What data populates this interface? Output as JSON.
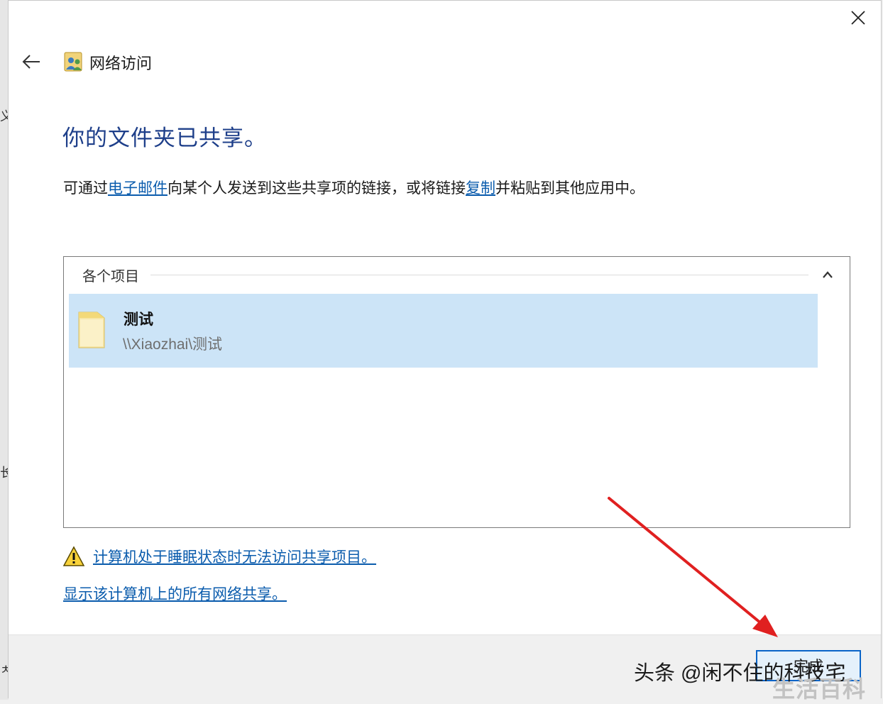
{
  "window": {
    "title": "网络访问"
  },
  "heading": "你的文件夹已共享。",
  "description": {
    "part1": "可通过",
    "email_link": "电子邮件",
    "part2": "向某个人发送到这些共享项的链接，或将链接",
    "copy_link": "复制",
    "part3": "并粘贴到其他应用中。"
  },
  "items_group": {
    "title": "各个项目",
    "items": [
      {
        "name": "测试",
        "path": "\\\\Xiaozhai\\测试",
        "icon": "folder-icon"
      }
    ]
  },
  "warning_link": "计算机处于睡眠状态时无法访问共享项目。",
  "show_shares_link": "显示该计算机上的所有网络共享。",
  "footer": {
    "done_label": "完成"
  },
  "watermark": {
    "text": "头条 @闲不住的科技宅",
    "text2": "生活百科"
  },
  "background_glyphs": [
    "义",
    "长",
    "ㅊ"
  ],
  "colors": {
    "heading": "#1e3f8a",
    "link": "#0b5cad",
    "selection": "#cce4f7",
    "button_border": "#0a64c8",
    "annotation_arrow": "#e02020"
  }
}
